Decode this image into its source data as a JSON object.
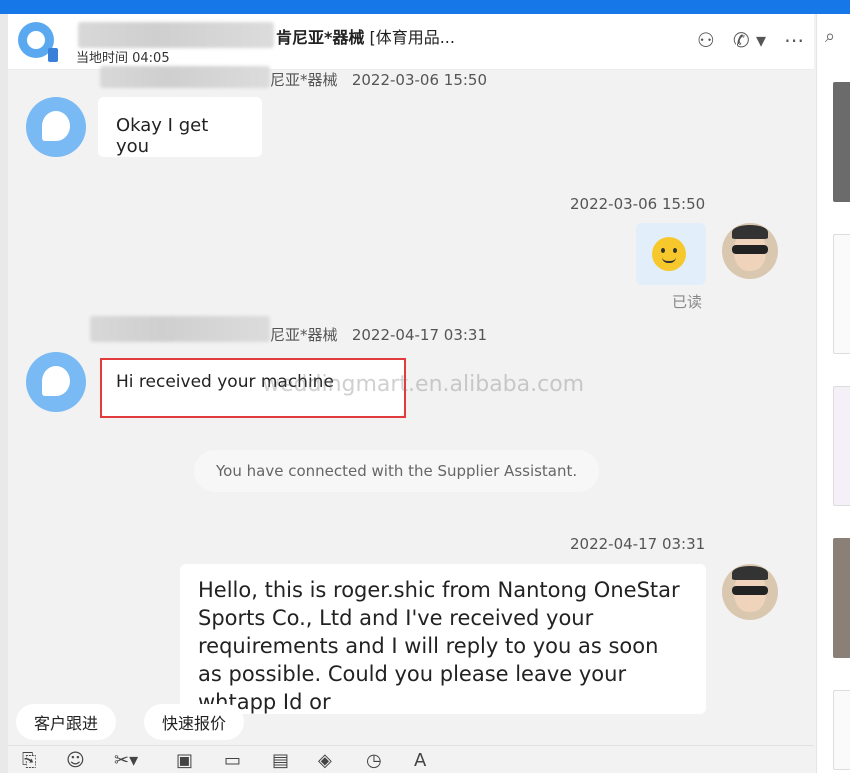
{
  "header": {
    "name_visible": "肯尼亚*器械",
    "category": "[体育用品...",
    "local_time": "当地时间 04:05",
    "icons": [
      "add-contact-icon",
      "phone-call-icon",
      "more-icon"
    ]
  },
  "messages": {
    "m1_sender": "尼亚*器械",
    "m1_time": "2022-03-06 15:50",
    "m1_text": "Okay I get you",
    "m2_time": "2022-03-06 15:50",
    "m2_emoji": "🙂",
    "m2_status": "已读",
    "m3_sender": "尼亚*器械",
    "m3_time": "2022-04-17 03:31",
    "m3_text": "Hi received your machine",
    "system_notice": "You have connected with the Supplier Assistant.",
    "m4_time": "2022-04-17 03:31",
    "m4_text": "Hello, this is roger.shic from Nantong OneStar Sports Co., Ltd and I've received your requirements and I will reply to you as soon as possible. Could you please leave your whtapp Id or"
  },
  "watermark": "weddingmart.en.alibaba.com",
  "quick_actions": [
    "客户跟进",
    "快速报价"
  ],
  "toolbar_icons": [
    "attachment-icon",
    "emoji-icon",
    "scissors-icon",
    "image-icon",
    "folder-icon",
    "calculator-icon",
    "package-icon",
    "clock-icon",
    "text-icon"
  ]
}
